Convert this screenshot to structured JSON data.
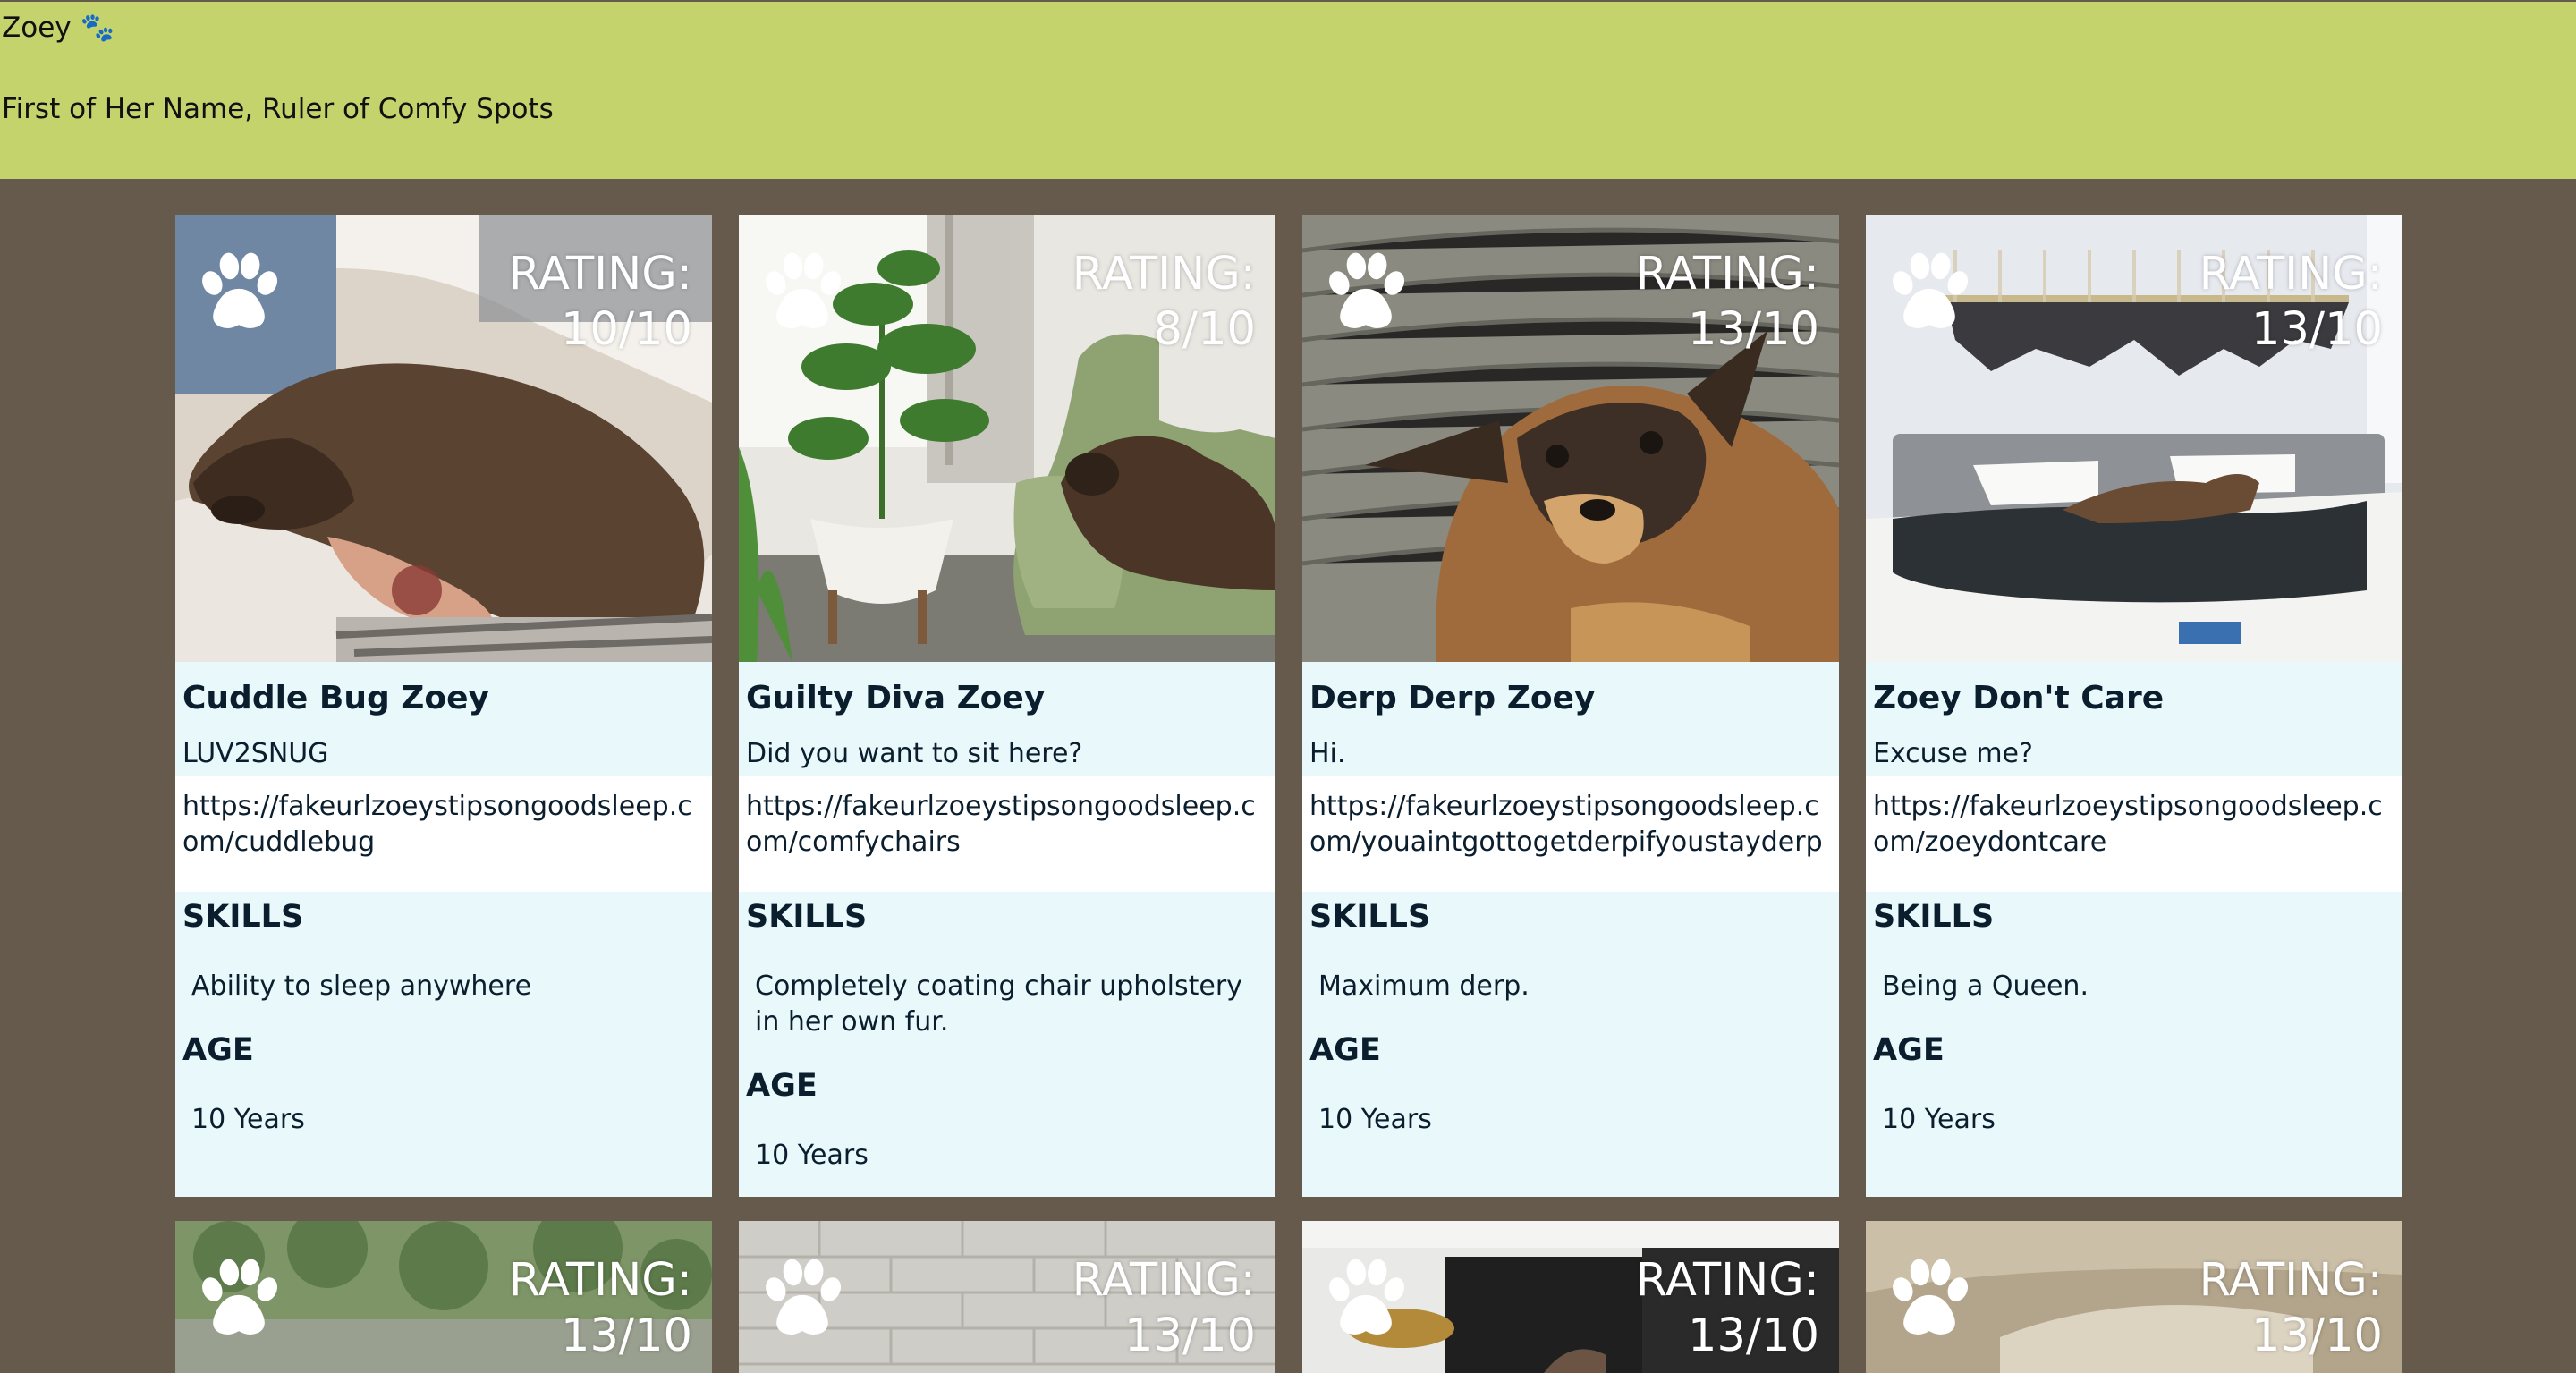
{
  "header": {
    "title": "Zoey 🐾",
    "tagline": "First of Her Name, Ruler of Comfy Spots"
  },
  "cards": [
    {
      "name": "Cuddle Bug Zoey",
      "tagline": "LUV2SNUG",
      "link": "https://fakeurlzoeystipsongoodsleep.com/cuddlebug",
      "rating_label": "RATING:",
      "rating": "10/10",
      "skills_label": "SKILLS",
      "skills": "Ability to sleep anywhere",
      "age_label": "AGE",
      "age": "10 Years"
    },
    {
      "name": "Guilty Diva Zoey",
      "tagline": "Did you want to sit here?",
      "link": "https://fakeurlzoeystipsongoodsleep.com/comfychairs",
      "rating_label": "RATING:",
      "rating": "8/10",
      "skills_label": "SKILLS",
      "skills": "Completely coating chair upholstery in her own fur.",
      "age_label": "AGE",
      "age": "10 Years"
    },
    {
      "name": "Derp Derp Zoey",
      "tagline": "Hi.",
      "link": "https://fakeurlzoeystipsongoodsleep.com/youaintgottogetderpifyoustayderp",
      "rating_label": "RATING:",
      "rating": "13/10",
      "skills_label": "SKILLS",
      "skills": "Maximum derp.",
      "age_label": "AGE",
      "age": "10 Years"
    },
    {
      "name": "Zoey Don't Care",
      "tagline": "Excuse me?",
      "link": "https://fakeurlzoeystipsongoodsleep.com/zoeydontcare",
      "rating_label": "RATING:",
      "rating": "13/10",
      "skills_label": "SKILLS",
      "skills": "Being a Queen.",
      "age_label": "AGE",
      "age": "10 Years"
    },
    {
      "rating_label": "RATING:",
      "rating": "13/10"
    },
    {
      "rating_label": "RATING:",
      "rating": "13/10"
    },
    {
      "rating_label": "RATING:",
      "rating": "13/10"
    },
    {
      "rating_label": "RATING:",
      "rating": "13/10"
    }
  ],
  "icons": {
    "paw": "paw-icon"
  },
  "colors": {
    "header_bg": "#c4d36c",
    "page_bg": "#655a4b",
    "card_bg": "#e9f8fb",
    "link_bg": "#ffffff",
    "text": "#0b1e2e"
  }
}
